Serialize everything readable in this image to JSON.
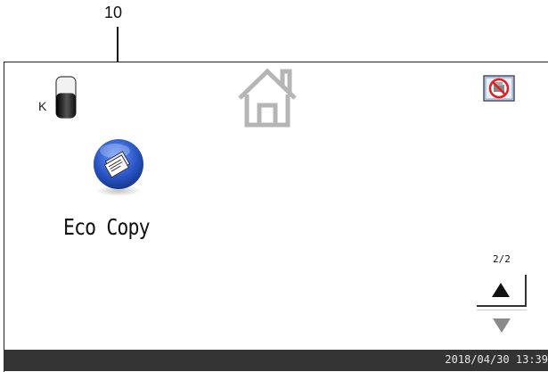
{
  "callout": {
    "number": "10"
  },
  "toner": {
    "label": "K",
    "level": 0.6
  },
  "home": {
    "icon": "home-icon"
  },
  "header": {
    "no_print_icon": "no-print-icon"
  },
  "apps": [
    {
      "label": "Eco Copy",
      "icon": "eco-copy-icon"
    }
  ],
  "pager": {
    "indicator": "2/2",
    "up_icon": "triangle-up-icon",
    "down_icon": "triangle-down-icon"
  },
  "status_bar": {
    "datetime": "2018/04/30 13:39"
  },
  "colors": {
    "accent": "#2a56c6",
    "status_bar": "#333333",
    "warning": "#e02020"
  }
}
